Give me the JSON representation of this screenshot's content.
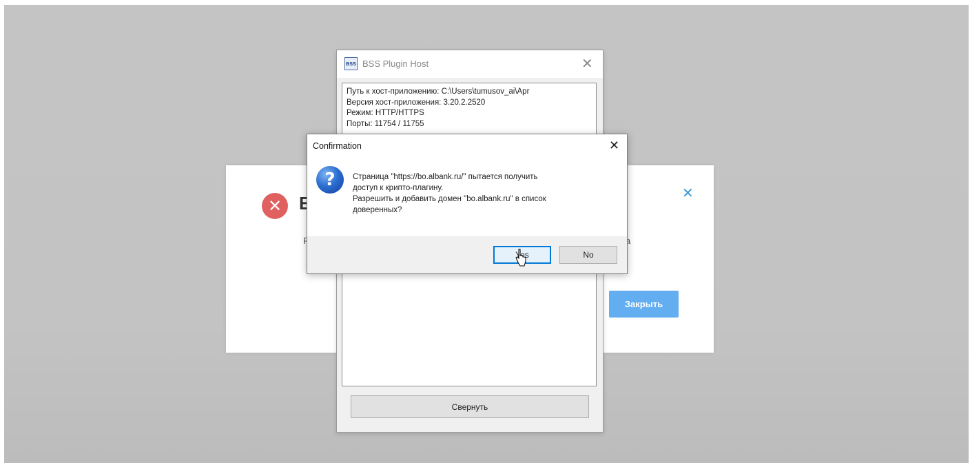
{
  "web_modal": {
    "error_icon": "error-x-icon",
    "title": "E",
    "text_fragment": "F",
    "text_fragment_right": "a",
    "close_icon": "close-icon",
    "close_button_label": "Закрыть",
    "accent_color": "#62aef0"
  },
  "bss_window": {
    "logo": "BSS",
    "title": "BSS Plugin Host",
    "close_icon": "close-icon",
    "info_lines": [
      "Путь к хост-приложению: C:\\Users\\tumusov_ai\\Apr",
      "Версия хост-приложения: 3.20.2.2520",
      "Режим: HTTP/HTTPS",
      "Порты: 11754 / 11755"
    ],
    "collapse_button_label": "Свернуть"
  },
  "confirmation": {
    "title": "Confirmation",
    "close_icon": "close-icon",
    "question_icon": "question-icon",
    "message_lines": [
      "Страница \"https://bo.albank.ru/\" пытается получить",
      "доступ к крипто-плагину.",
      "Разрешить и добавить домен \"bo.albank.ru\" в список",
      "доверенных?"
    ],
    "yes_label": "Yes",
    "no_label": "No",
    "focus_color": "#0078d7"
  }
}
